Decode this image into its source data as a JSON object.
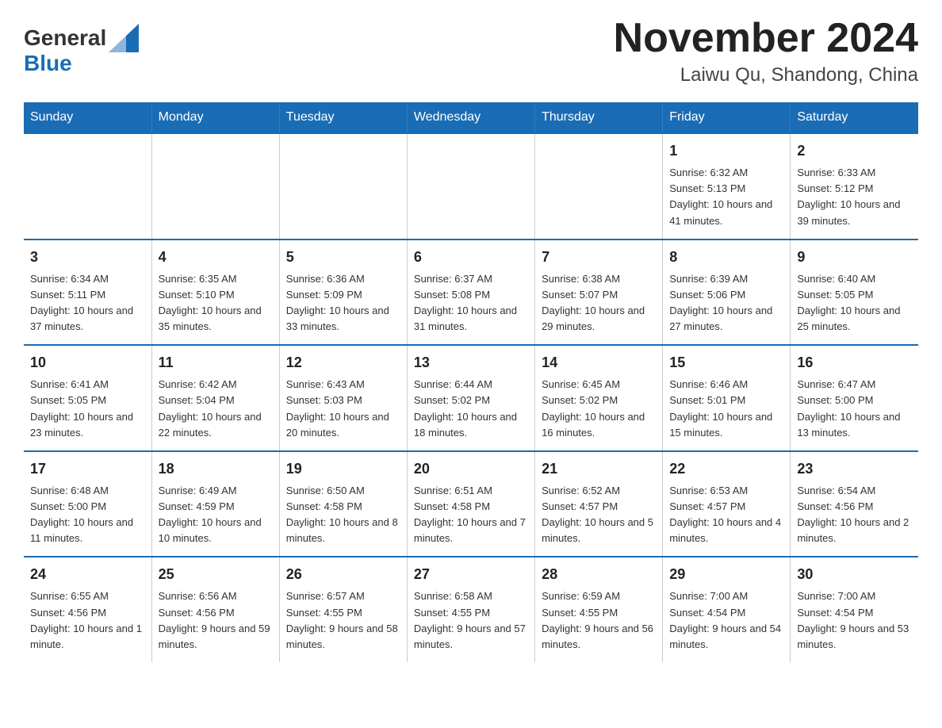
{
  "header": {
    "logo_general": "General",
    "logo_blue": "Blue",
    "month_year": "November 2024",
    "location": "Laiwu Qu, Shandong, China"
  },
  "weekdays": [
    "Sunday",
    "Monday",
    "Tuesday",
    "Wednesday",
    "Thursday",
    "Friday",
    "Saturday"
  ],
  "weeks": [
    [
      {
        "day": "",
        "info": ""
      },
      {
        "day": "",
        "info": ""
      },
      {
        "day": "",
        "info": ""
      },
      {
        "day": "",
        "info": ""
      },
      {
        "day": "",
        "info": ""
      },
      {
        "day": "1",
        "info": "Sunrise: 6:32 AM\nSunset: 5:13 PM\nDaylight: 10 hours and 41 minutes."
      },
      {
        "day": "2",
        "info": "Sunrise: 6:33 AM\nSunset: 5:12 PM\nDaylight: 10 hours and 39 minutes."
      }
    ],
    [
      {
        "day": "3",
        "info": "Sunrise: 6:34 AM\nSunset: 5:11 PM\nDaylight: 10 hours and 37 minutes."
      },
      {
        "day": "4",
        "info": "Sunrise: 6:35 AM\nSunset: 5:10 PM\nDaylight: 10 hours and 35 minutes."
      },
      {
        "day": "5",
        "info": "Sunrise: 6:36 AM\nSunset: 5:09 PM\nDaylight: 10 hours and 33 minutes."
      },
      {
        "day": "6",
        "info": "Sunrise: 6:37 AM\nSunset: 5:08 PM\nDaylight: 10 hours and 31 minutes."
      },
      {
        "day": "7",
        "info": "Sunrise: 6:38 AM\nSunset: 5:07 PM\nDaylight: 10 hours and 29 minutes."
      },
      {
        "day": "8",
        "info": "Sunrise: 6:39 AM\nSunset: 5:06 PM\nDaylight: 10 hours and 27 minutes."
      },
      {
        "day": "9",
        "info": "Sunrise: 6:40 AM\nSunset: 5:05 PM\nDaylight: 10 hours and 25 minutes."
      }
    ],
    [
      {
        "day": "10",
        "info": "Sunrise: 6:41 AM\nSunset: 5:05 PM\nDaylight: 10 hours and 23 minutes."
      },
      {
        "day": "11",
        "info": "Sunrise: 6:42 AM\nSunset: 5:04 PM\nDaylight: 10 hours and 22 minutes."
      },
      {
        "day": "12",
        "info": "Sunrise: 6:43 AM\nSunset: 5:03 PM\nDaylight: 10 hours and 20 minutes."
      },
      {
        "day": "13",
        "info": "Sunrise: 6:44 AM\nSunset: 5:02 PM\nDaylight: 10 hours and 18 minutes."
      },
      {
        "day": "14",
        "info": "Sunrise: 6:45 AM\nSunset: 5:02 PM\nDaylight: 10 hours and 16 minutes."
      },
      {
        "day": "15",
        "info": "Sunrise: 6:46 AM\nSunset: 5:01 PM\nDaylight: 10 hours and 15 minutes."
      },
      {
        "day": "16",
        "info": "Sunrise: 6:47 AM\nSunset: 5:00 PM\nDaylight: 10 hours and 13 minutes."
      }
    ],
    [
      {
        "day": "17",
        "info": "Sunrise: 6:48 AM\nSunset: 5:00 PM\nDaylight: 10 hours and 11 minutes."
      },
      {
        "day": "18",
        "info": "Sunrise: 6:49 AM\nSunset: 4:59 PM\nDaylight: 10 hours and 10 minutes."
      },
      {
        "day": "19",
        "info": "Sunrise: 6:50 AM\nSunset: 4:58 PM\nDaylight: 10 hours and 8 minutes."
      },
      {
        "day": "20",
        "info": "Sunrise: 6:51 AM\nSunset: 4:58 PM\nDaylight: 10 hours and 7 minutes."
      },
      {
        "day": "21",
        "info": "Sunrise: 6:52 AM\nSunset: 4:57 PM\nDaylight: 10 hours and 5 minutes."
      },
      {
        "day": "22",
        "info": "Sunrise: 6:53 AM\nSunset: 4:57 PM\nDaylight: 10 hours and 4 minutes."
      },
      {
        "day": "23",
        "info": "Sunrise: 6:54 AM\nSunset: 4:56 PM\nDaylight: 10 hours and 2 minutes."
      }
    ],
    [
      {
        "day": "24",
        "info": "Sunrise: 6:55 AM\nSunset: 4:56 PM\nDaylight: 10 hours and 1 minute."
      },
      {
        "day": "25",
        "info": "Sunrise: 6:56 AM\nSunset: 4:56 PM\nDaylight: 9 hours and 59 minutes."
      },
      {
        "day": "26",
        "info": "Sunrise: 6:57 AM\nSunset: 4:55 PM\nDaylight: 9 hours and 58 minutes."
      },
      {
        "day": "27",
        "info": "Sunrise: 6:58 AM\nSunset: 4:55 PM\nDaylight: 9 hours and 57 minutes."
      },
      {
        "day": "28",
        "info": "Sunrise: 6:59 AM\nSunset: 4:55 PM\nDaylight: 9 hours and 56 minutes."
      },
      {
        "day": "29",
        "info": "Sunrise: 7:00 AM\nSunset: 4:54 PM\nDaylight: 9 hours and 54 minutes."
      },
      {
        "day": "30",
        "info": "Sunrise: 7:00 AM\nSunset: 4:54 PM\nDaylight: 9 hours and 53 minutes."
      }
    ]
  ]
}
